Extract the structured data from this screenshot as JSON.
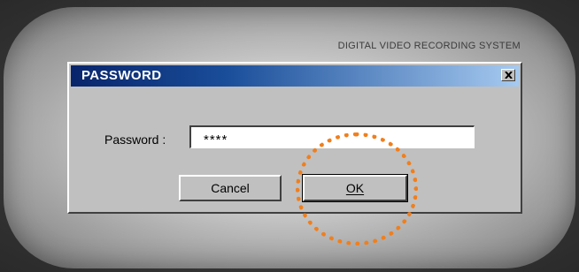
{
  "app": {
    "system_label": "DIGITAL VIDEO RECORDING SYSTEM"
  },
  "dialog": {
    "title": "PASSWORD",
    "close_icon": "close-x-icon",
    "password_label": "Password :",
    "password_value": "****",
    "cancel_label": "Cancel",
    "ok_label": "OK"
  },
  "annotation": {
    "highlight_color": "#f07f1d",
    "highlight_target": "ok-button"
  },
  "colors": {
    "titlebar_start": "#08246b",
    "titlebar_end": "#a6caf0",
    "dialog_face": "#c0c0c0"
  }
}
